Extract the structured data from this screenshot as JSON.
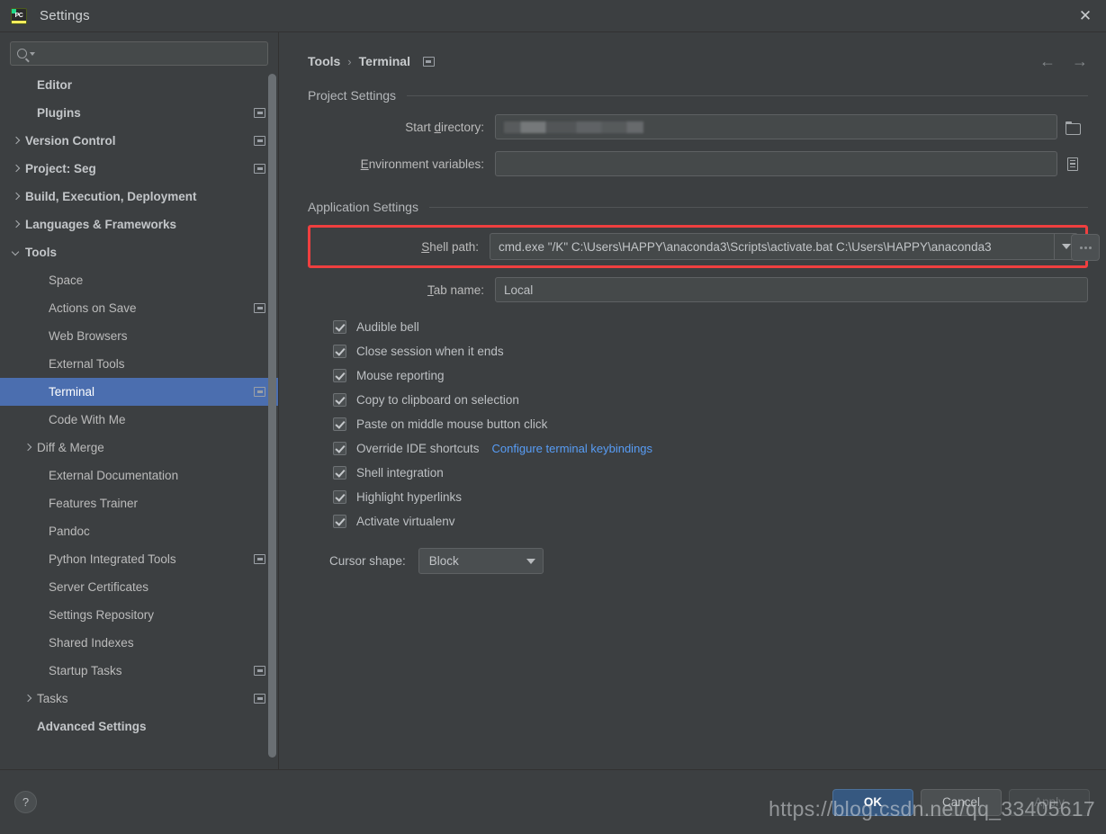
{
  "window": {
    "title": "Settings",
    "app_icon": "pycharm-icon",
    "icon_text": "PC",
    "close_label": "✕"
  },
  "search": {
    "value": "",
    "placeholder": ""
  },
  "sidebar": {
    "items": [
      {
        "label": "Editor",
        "indent": 1,
        "arrow": "none",
        "bold": true,
        "project_icon": false,
        "selected": false
      },
      {
        "label": "Plugins",
        "indent": 1,
        "arrow": "none",
        "bold": true,
        "project_icon": true,
        "selected": false
      },
      {
        "label": "Version Control",
        "indent": 0,
        "arrow": "right",
        "bold": true,
        "project_icon": true,
        "selected": false
      },
      {
        "label": "Project: Seg",
        "indent": 0,
        "arrow": "right",
        "bold": true,
        "project_icon": true,
        "selected": false
      },
      {
        "label": "Build, Execution, Deployment",
        "indent": 0,
        "arrow": "right",
        "bold": true,
        "project_icon": false,
        "selected": false
      },
      {
        "label": "Languages & Frameworks",
        "indent": 0,
        "arrow": "right",
        "bold": true,
        "project_icon": false,
        "selected": false
      },
      {
        "label": "Tools",
        "indent": 0,
        "arrow": "down",
        "bold": true,
        "project_icon": false,
        "selected": false
      },
      {
        "label": "Space",
        "indent": 2,
        "arrow": "none",
        "bold": false,
        "project_icon": false,
        "selected": false
      },
      {
        "label": "Actions on Save",
        "indent": 2,
        "arrow": "none",
        "bold": false,
        "project_icon": true,
        "selected": false
      },
      {
        "label": "Web Browsers",
        "indent": 2,
        "arrow": "none",
        "bold": false,
        "project_icon": false,
        "selected": false
      },
      {
        "label": "External Tools",
        "indent": 2,
        "arrow": "none",
        "bold": false,
        "project_icon": false,
        "selected": false
      },
      {
        "label": "Terminal",
        "indent": 2,
        "arrow": "none",
        "bold": false,
        "project_icon": true,
        "selected": true
      },
      {
        "label": "Code With Me",
        "indent": 2,
        "arrow": "none",
        "bold": false,
        "project_icon": false,
        "selected": false
      },
      {
        "label": "Diff & Merge",
        "indent": 1,
        "arrow": "right",
        "bold": false,
        "project_icon": false,
        "selected": false
      },
      {
        "label": "External Documentation",
        "indent": 2,
        "arrow": "none",
        "bold": false,
        "project_icon": false,
        "selected": false
      },
      {
        "label": "Features Trainer",
        "indent": 2,
        "arrow": "none",
        "bold": false,
        "project_icon": false,
        "selected": false
      },
      {
        "label": "Pandoc",
        "indent": 2,
        "arrow": "none",
        "bold": false,
        "project_icon": false,
        "selected": false
      },
      {
        "label": "Python Integrated Tools",
        "indent": 2,
        "arrow": "none",
        "bold": false,
        "project_icon": true,
        "selected": false
      },
      {
        "label": "Server Certificates",
        "indent": 2,
        "arrow": "none",
        "bold": false,
        "project_icon": false,
        "selected": false
      },
      {
        "label": "Settings Repository",
        "indent": 2,
        "arrow": "none",
        "bold": false,
        "project_icon": false,
        "selected": false
      },
      {
        "label": "Shared Indexes",
        "indent": 2,
        "arrow": "none",
        "bold": false,
        "project_icon": false,
        "selected": false
      },
      {
        "label": "Startup Tasks",
        "indent": 2,
        "arrow": "none",
        "bold": false,
        "project_icon": true,
        "selected": false
      },
      {
        "label": "Tasks",
        "indent": 1,
        "arrow": "right",
        "bold": false,
        "project_icon": true,
        "selected": false
      },
      {
        "label": "Advanced Settings",
        "indent": 1,
        "arrow": "none",
        "bold": true,
        "project_icon": false,
        "selected": false
      }
    ]
  },
  "breadcrumb": {
    "parent": "Tools",
    "separator": "›",
    "current": "Terminal"
  },
  "nav": {
    "back": "←",
    "forward": "→"
  },
  "project_settings": {
    "heading": "Project Settings",
    "start_directory": {
      "label_pre": "Start ",
      "label_key": "d",
      "label_post": "irectory:",
      "value": "",
      "redacted": true,
      "button_icon": "folder-icon"
    },
    "environment_variables": {
      "label_pre": "",
      "label_key": "E",
      "label_post": "nvironment variables:",
      "value": "",
      "button_icon": "list-icon"
    }
  },
  "application_settings": {
    "heading": "Application Settings",
    "shell_path": {
      "label_pre": "",
      "label_key": "S",
      "label_post": "hell path:",
      "value": "cmd.exe \"/K\" C:\\Users\\HAPPY\\anaconda3\\Scripts\\activate.bat C:\\Users\\HAPPY\\anaconda3",
      "highlight_color": "#ef3f3f",
      "browse_label": "..."
    },
    "tab_name": {
      "label_pre": "",
      "label_key": "T",
      "label_post": "ab name:",
      "value": "Local"
    },
    "checkboxes": [
      {
        "label": "Audible bell",
        "checked": true,
        "link": null
      },
      {
        "label": "Close session when it ends",
        "checked": true,
        "link": null
      },
      {
        "label": "Mouse reporting",
        "checked": true,
        "link": null
      },
      {
        "label": "Copy to clipboard on selection",
        "checked": true,
        "link": null
      },
      {
        "label": "Paste on middle mouse button click",
        "checked": true,
        "link": null
      },
      {
        "label": "Override IDE shortcuts",
        "checked": true,
        "link": "Configure terminal keybindings"
      },
      {
        "label": "Shell integration",
        "checked": true,
        "link": null
      },
      {
        "label": "Highlight hyperlinks",
        "checked": true,
        "link": null
      },
      {
        "label": "Activate virtualenv",
        "checked": true,
        "link": null
      }
    ],
    "cursor_shape": {
      "label": "Cursor shape:",
      "value": "Block"
    }
  },
  "footer": {
    "help_label": "?",
    "ok_label": "OK",
    "cancel_label": "Cancel",
    "apply_label": "Apply",
    "apply_disabled": true
  },
  "watermark": "https://blog.csdn.net/qq_33405617",
  "colors": {
    "accent_selection": "#4b6eaf",
    "primary_button": "#365880",
    "link": "#589df6",
    "highlight_box": "#ef3f3f",
    "panel_bg": "#3c3f41",
    "input_bg": "#45494a"
  }
}
